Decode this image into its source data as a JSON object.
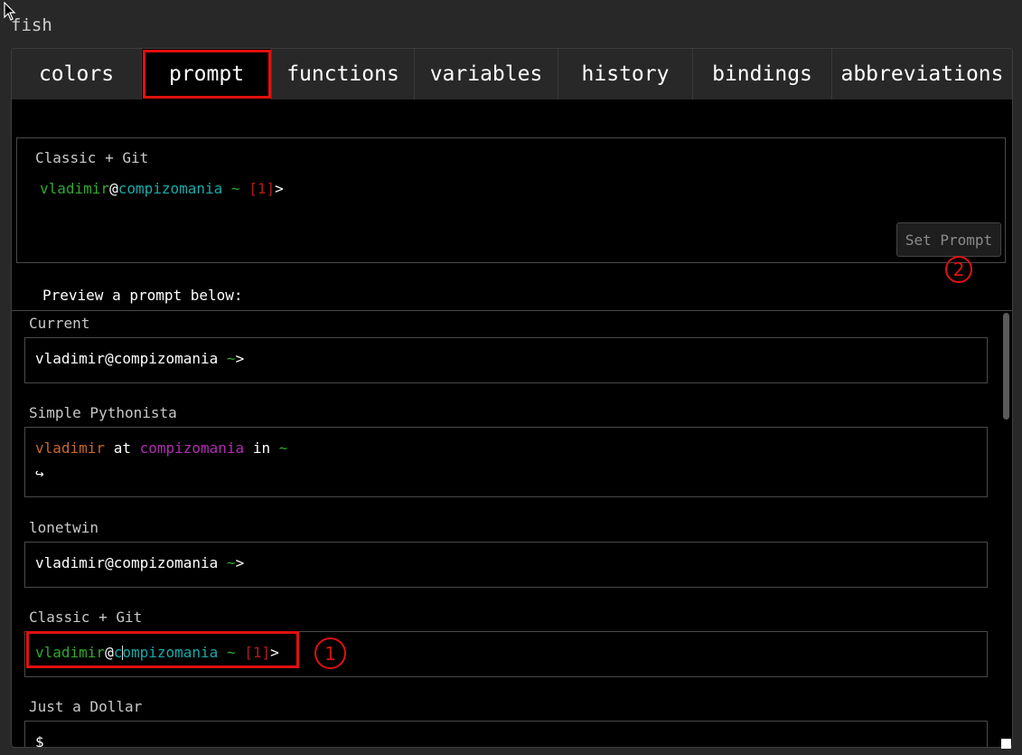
{
  "app": {
    "title": "fish"
  },
  "tabs": [
    {
      "label": "colors"
    },
    {
      "label": "prompt"
    },
    {
      "label": "functions"
    },
    {
      "label": "variables"
    },
    {
      "label": "history"
    },
    {
      "label": "bindings"
    },
    {
      "label": "abbreviations"
    }
  ],
  "selected_prompt": {
    "name": "Classic + Git",
    "user": "vladimir",
    "at": "@",
    "host": "compizomania",
    "path": " ~ ",
    "status": "[1]",
    "suffix": ">"
  },
  "set_prompt_button": {
    "label": "Set Prompt"
  },
  "markers": {
    "one": "1",
    "two": "2"
  },
  "preview_label": "Preview a prompt below:",
  "prompts": [
    {
      "name": "Current",
      "user_host": "vladimir@compizomania",
      "path": " ~",
      "suffix": ">"
    },
    {
      "name": "Simple Pythonista",
      "user": "vladimir",
      "at_word": " at ",
      "host": "compizomania",
      "in_word": " in ",
      "path": "~",
      "second_line": "↪"
    },
    {
      "name": "lonetwin",
      "user_host": "vladimir@compizomania",
      "path": " ~",
      "suffix": ">"
    },
    {
      "name": "Classic + Git",
      "user": "vladimir",
      "at": "@",
      "host_first": "c",
      "host_rest": "ompizomania",
      "path": " ~ ",
      "status": "[1]",
      "suffix": ">"
    },
    {
      "name": "Just a Dollar",
      "line": "$"
    }
  ],
  "colors": {
    "user_green": "#2ea82e",
    "host_cyan": "#1aa8a8",
    "status_red": "#b01c1c",
    "pythonista_orange": "#c8682a",
    "pythonista_magenta": "#b02cb0",
    "annotation_red": "#e01010"
  }
}
